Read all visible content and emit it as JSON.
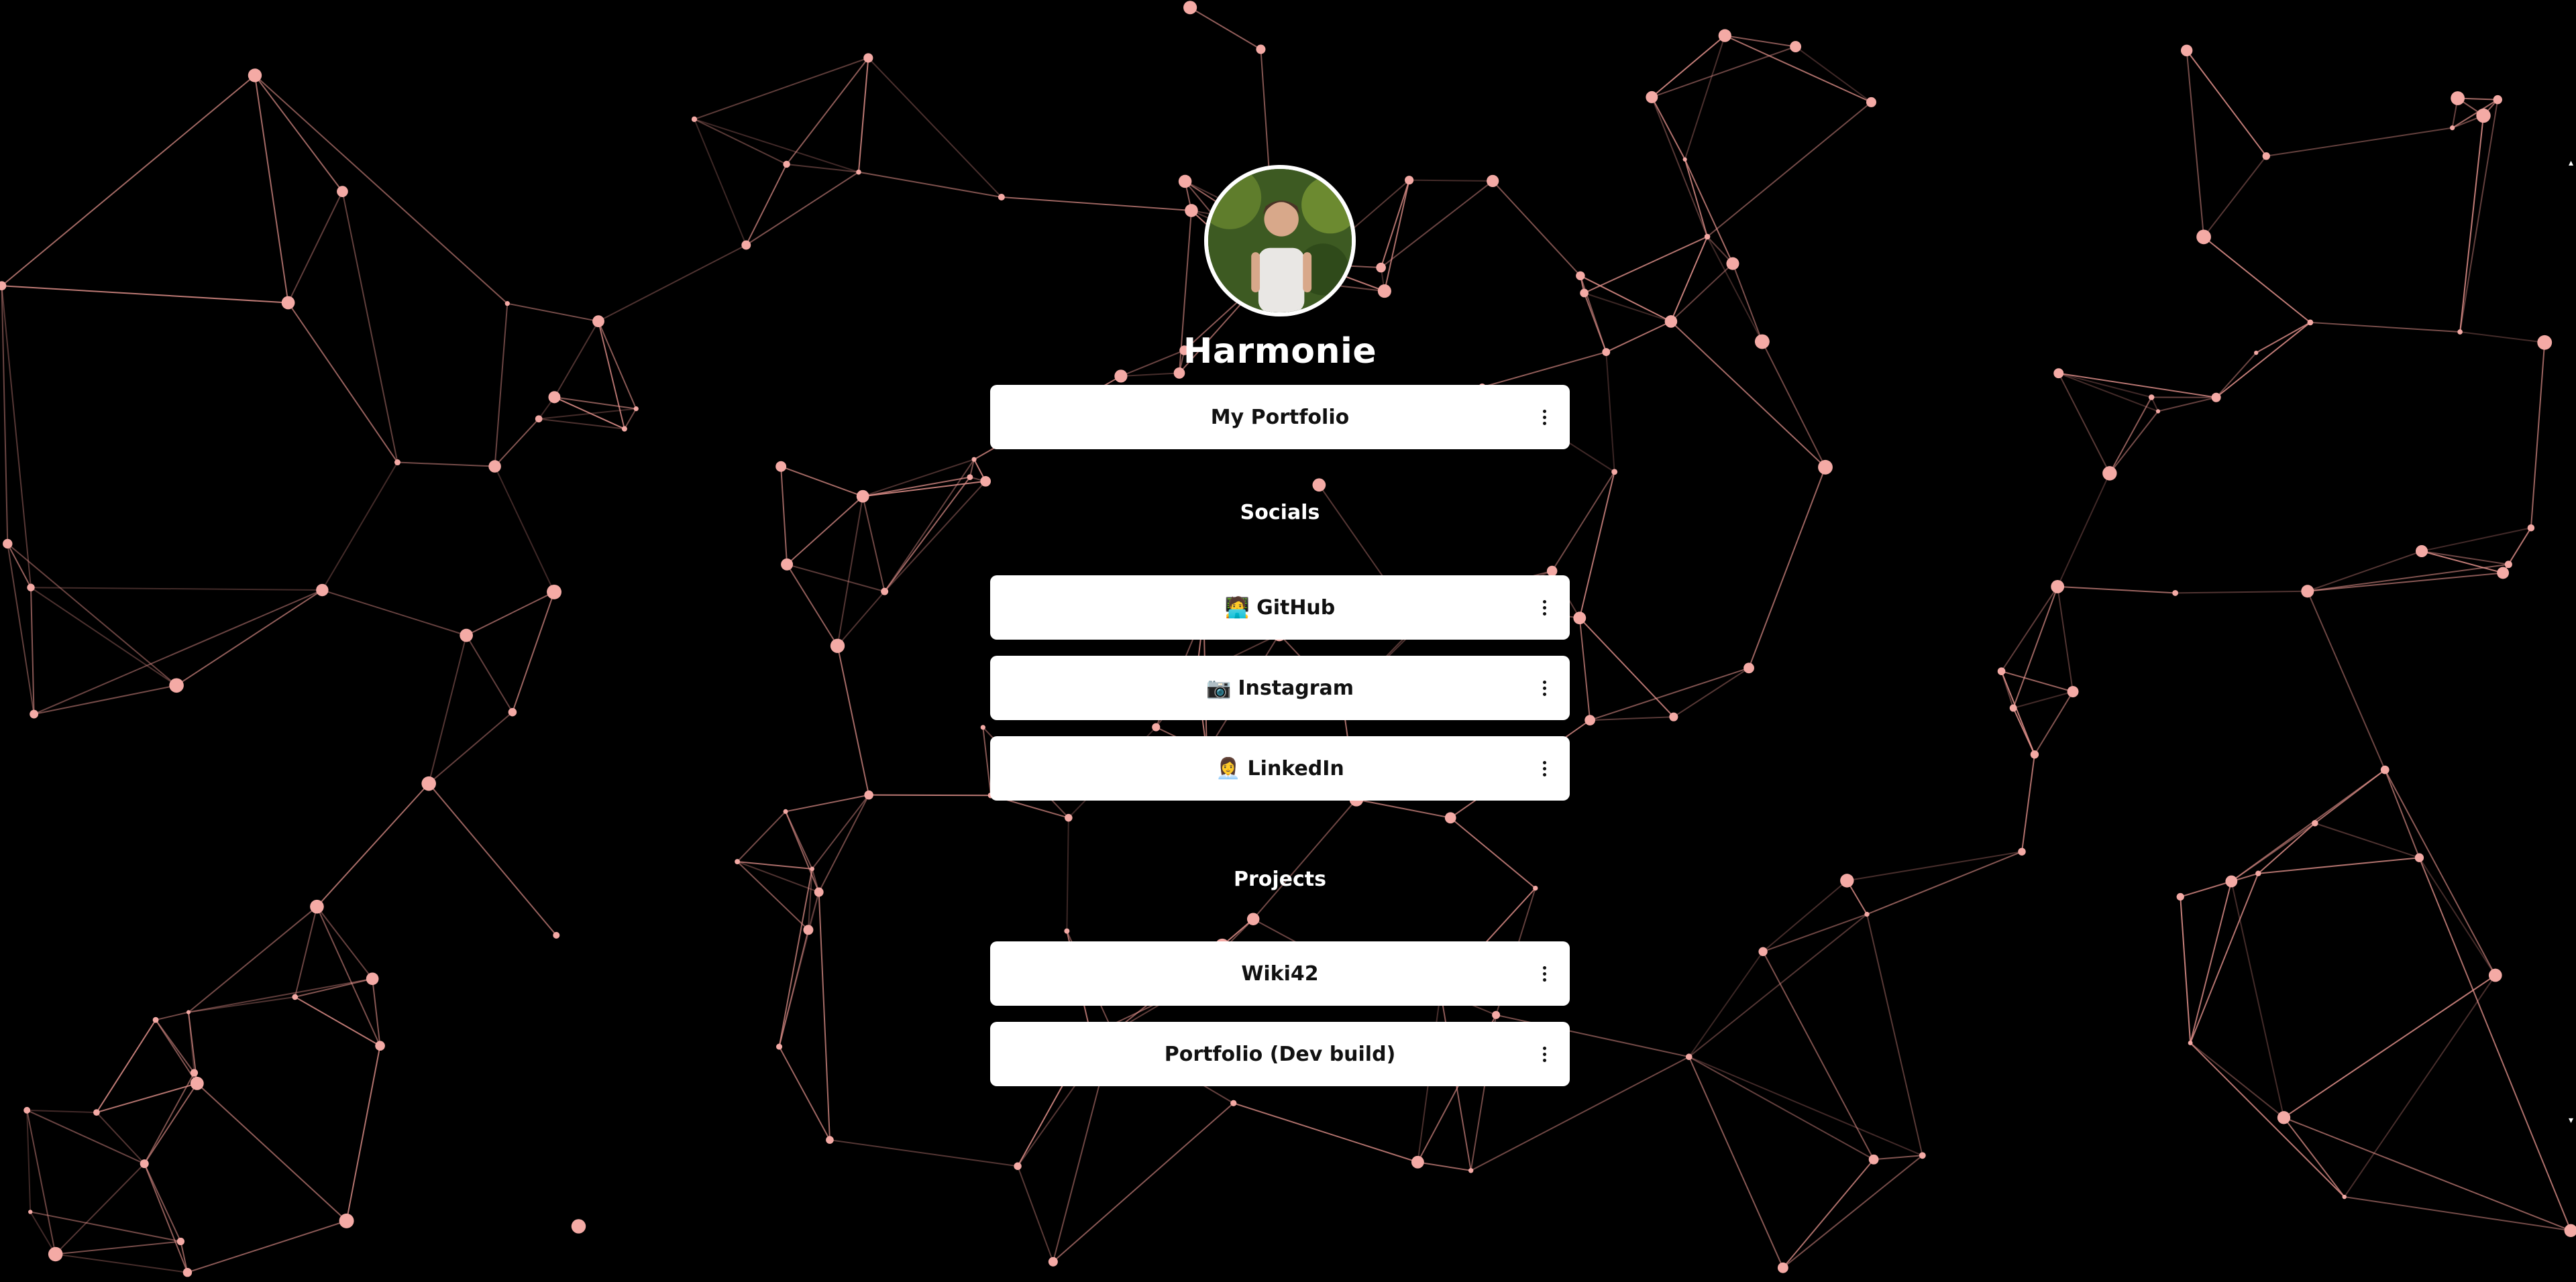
{
  "profile": {
    "name": "Harmonie",
    "avatar_alt": "profile photo"
  },
  "links": {
    "portfolio": {
      "label": "My Portfolio",
      "icon": "",
      "menu_icon": "kebab-menu-icon"
    }
  },
  "sections": {
    "socials": {
      "title": "Socials",
      "items": [
        {
          "icon": "🧑‍💻",
          "label": "GitHub"
        },
        {
          "icon": "📷",
          "label": "Instagram"
        },
        {
          "icon": "👩‍💼",
          "label": "LinkedIn"
        }
      ]
    },
    "projects": {
      "title": "Projects",
      "items": [
        {
          "label": "Wiki42"
        },
        {
          "label": "Portfolio (Dev build)"
        }
      ]
    }
  },
  "colors": {
    "background": "#000000",
    "network_line": "#e8958f",
    "network_node": "#f4aaa5",
    "button_bg": "#ffffff",
    "button_text": "#111111"
  }
}
